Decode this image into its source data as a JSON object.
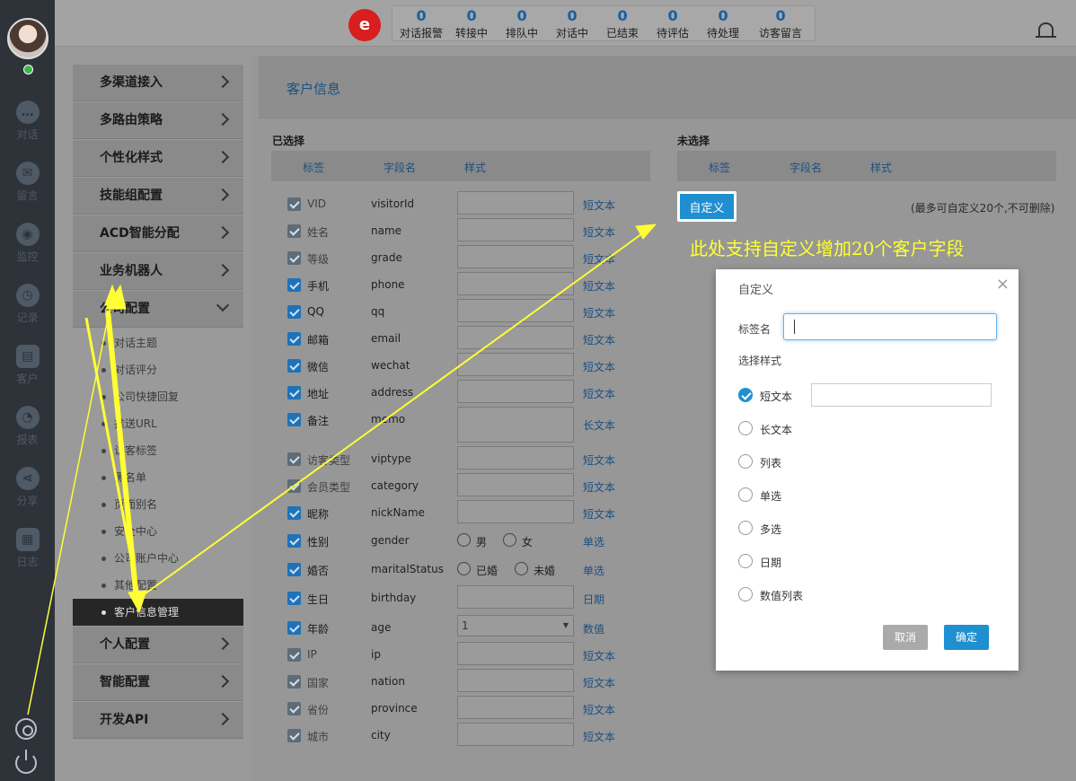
{
  "nav": {
    "items": [
      {
        "label": "对话",
        "icon": "chat-icon"
      },
      {
        "label": "留言",
        "icon": "mail-icon"
      },
      {
        "label": "监控",
        "icon": "eye-icon"
      },
      {
        "label": "记录",
        "icon": "clock-icon"
      },
      {
        "label": "客户",
        "icon": "id-card-icon"
      },
      {
        "label": "报表",
        "icon": "pie-chart-icon"
      },
      {
        "label": "分享",
        "icon": "share-icon"
      },
      {
        "label": "日志",
        "icon": "clipboard-icon"
      }
    ]
  },
  "header": {
    "logo": "e",
    "stats": [
      {
        "value": "0",
        "label": "对话报警"
      },
      {
        "value": "0",
        "label": "转接中"
      },
      {
        "value": "0",
        "label": "排队中"
      },
      {
        "value": "0",
        "label": "对话中"
      },
      {
        "value": "0",
        "label": "已结束"
      },
      {
        "value": "0",
        "label": "待评估"
      },
      {
        "value": "0",
        "label": "待处理"
      },
      {
        "value": "0",
        "label": "访客留言"
      }
    ]
  },
  "menu": {
    "items": [
      "多渠道接入",
      "多路由策略",
      "个性化样式",
      "技能组配置",
      "ACD智能分配",
      "业务机器人",
      "公司配置"
    ],
    "company_sub": [
      "对话主题",
      "对话评分",
      "公司快捷回复",
      "推送URL",
      "访客标签",
      "黑名单",
      "页面别名",
      "安全中心",
      "公司账户中心",
      "其他配置",
      "客户信息管理"
    ],
    "tail_items": [
      "个人配置",
      "智能配置",
      "开发API"
    ]
  },
  "content": {
    "title": "客户信息",
    "selected_heading": "已选择",
    "unselected_heading": "未选择",
    "columns": [
      "标签",
      "字段名",
      "样式"
    ],
    "rows": [
      {
        "label": "VID",
        "field": "visitorId",
        "type": "短文本",
        "checked": false,
        "input": "text"
      },
      {
        "label": "姓名",
        "field": "name",
        "type": "短文本",
        "checked": false,
        "input": "text"
      },
      {
        "label": "等级",
        "field": "grade",
        "type": "短文本",
        "checked": false,
        "input": "text"
      },
      {
        "label": "手机",
        "field": "phone",
        "type": "短文本",
        "checked": true,
        "input": "text"
      },
      {
        "label": "QQ",
        "field": "qq",
        "type": "短文本",
        "checked": true,
        "input": "text"
      },
      {
        "label": "邮箱",
        "field": "email",
        "type": "短文本",
        "checked": true,
        "input": "text"
      },
      {
        "label": "微信",
        "field": "wechat",
        "type": "短文本",
        "checked": true,
        "input": "text"
      },
      {
        "label": "地址",
        "field": "address",
        "type": "短文本",
        "checked": true,
        "input": "text"
      },
      {
        "label": "备注",
        "field": "memo",
        "type": "长文本",
        "checked": true,
        "input": "textarea"
      },
      {
        "label": "访客类型",
        "field": "viptype",
        "type": "短文本",
        "checked": false,
        "input": "text"
      },
      {
        "label": "会员类型",
        "field": "category",
        "type": "短文本",
        "checked": false,
        "input": "text"
      },
      {
        "label": "昵称",
        "field": "nickName",
        "type": "短文本",
        "checked": true,
        "input": "text"
      },
      {
        "label": "性别",
        "field": "gender",
        "type": "单选",
        "checked": true,
        "input": "radio",
        "options": [
          "男",
          "女"
        ]
      },
      {
        "label": "婚否",
        "field": "maritalStatus",
        "type": "单选",
        "checked": true,
        "input": "radio",
        "options": [
          "已婚",
          "未婚"
        ]
      },
      {
        "label": "生日",
        "field": "birthday",
        "type": "日期",
        "checked": true,
        "input": "text"
      },
      {
        "label": "年龄",
        "field": "age",
        "type": "数值",
        "checked": true,
        "input": "select",
        "value": "1"
      },
      {
        "label": "IP",
        "field": "ip",
        "type": "短文本",
        "checked": false,
        "input": "text"
      },
      {
        "label": "国家",
        "field": "nation",
        "type": "短文本",
        "checked": false,
        "input": "text"
      },
      {
        "label": "省份",
        "field": "province",
        "type": "短文本",
        "checked": false,
        "input": "text"
      },
      {
        "label": "城市",
        "field": "city",
        "type": "短文本",
        "checked": false,
        "input": "text"
      }
    ],
    "custom_button": "自定义",
    "custom_note": "(最多可自定义20个,不可删除)",
    "annotation": "此处支持自定义增加20个客户字段"
  },
  "dialog": {
    "title": "自定义",
    "close": "×",
    "label_name": "标签名",
    "label_name_value": "",
    "style_heading": "选择样式",
    "options": [
      "短文本",
      "长文本",
      "列表",
      "单选",
      "多选",
      "日期",
      "数值列表"
    ],
    "selected": "短文本",
    "cancel": "取消",
    "ok": "确定"
  },
  "colors": {
    "accent": "#1f8fcf",
    "annotation": "#ffff33",
    "logo": "#d81e1e",
    "rail": "#2d3339"
  }
}
